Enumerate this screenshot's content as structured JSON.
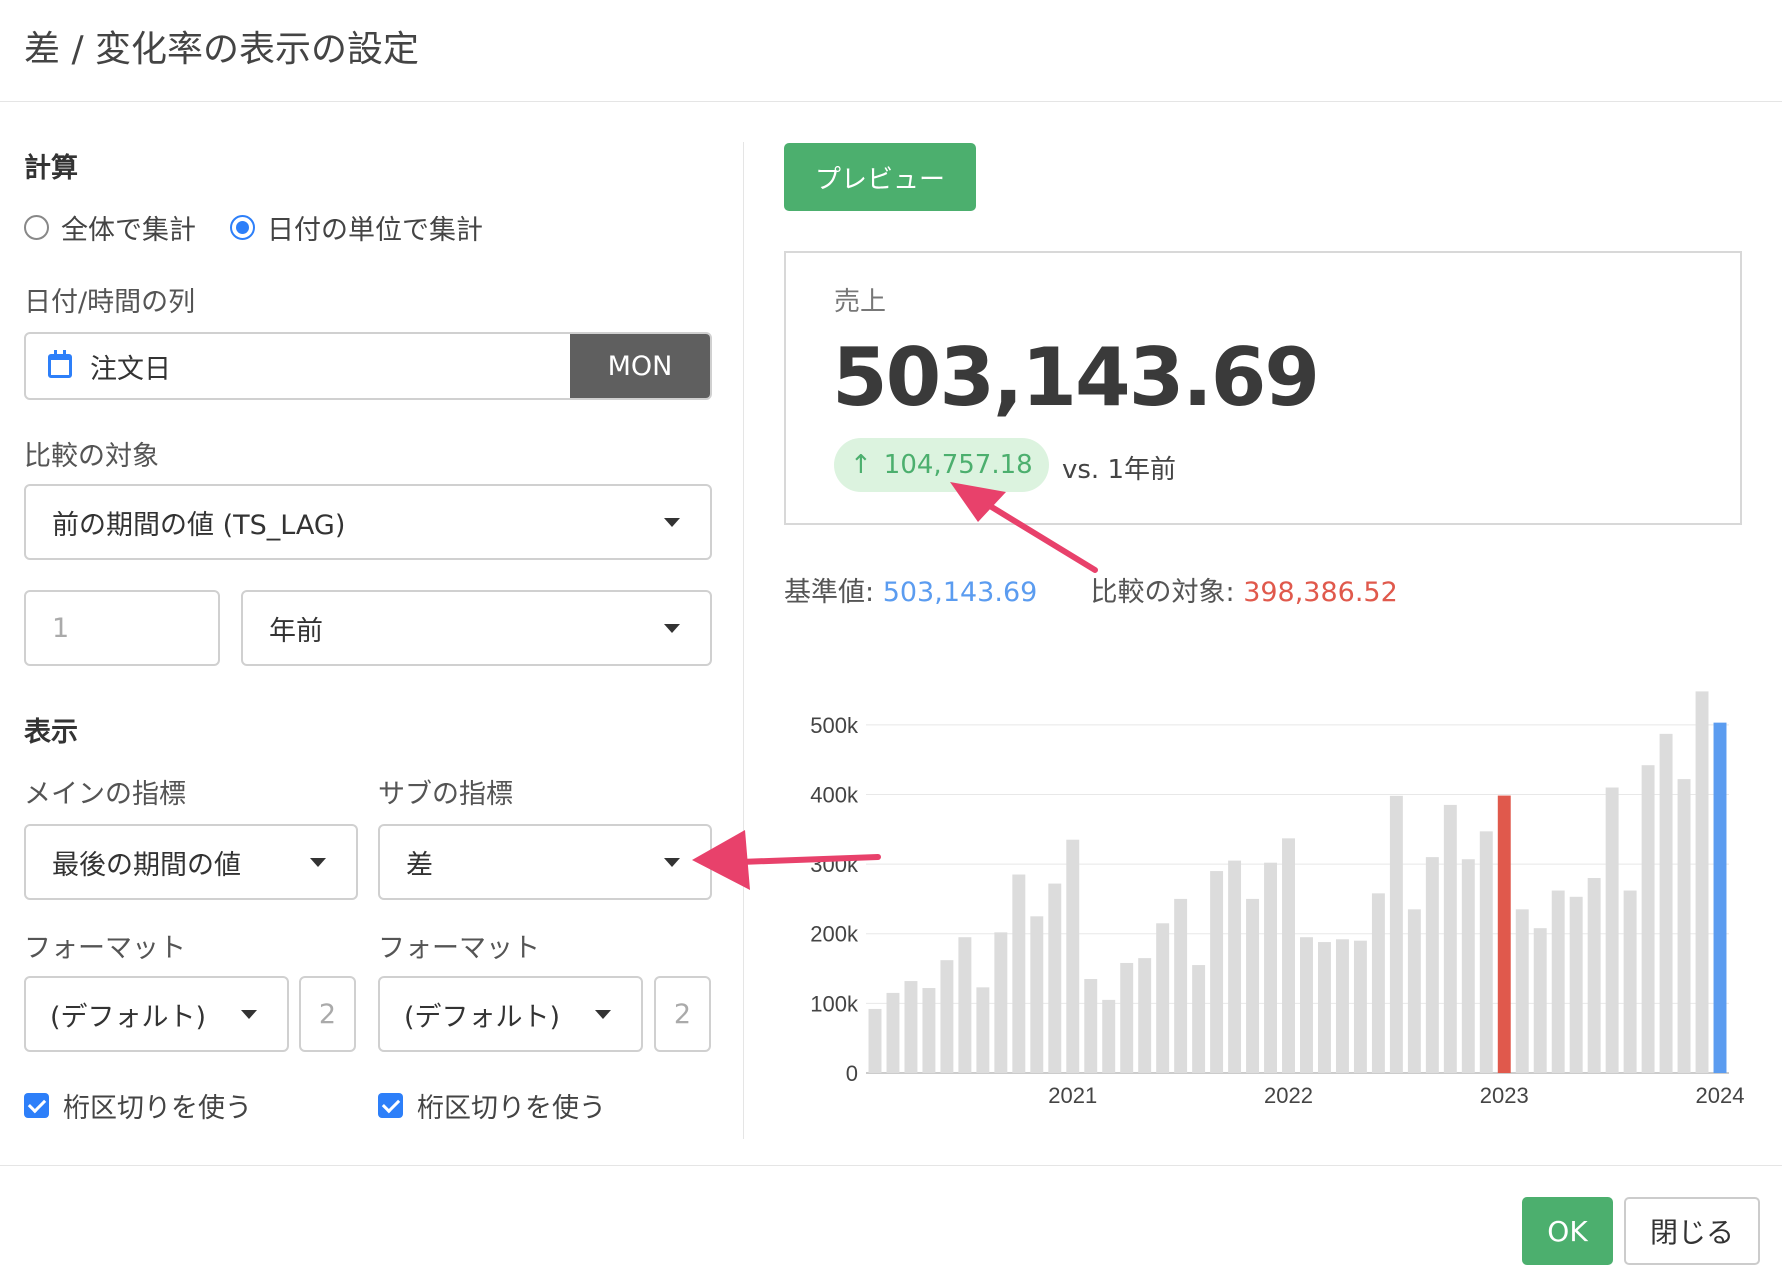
{
  "dialog": {
    "title": "差 / 変化率の表示の設定",
    "ok_label": "OK",
    "close_label": "閉じる"
  },
  "calc": {
    "section_title": "計算",
    "options": [
      "全体で集計",
      "日付の単位で集計"
    ],
    "selected_index": 1
  },
  "date_column": {
    "label": "日付/時間の列",
    "value": "注文日",
    "unit": "MON"
  },
  "compare": {
    "label": "比較の対象",
    "method": "前の期間の値 (TS_LAG)",
    "lag_placeholder": "1",
    "period": "年前"
  },
  "display": {
    "section_title": "表示",
    "main_metric_label": "メインの指標",
    "main_metric_value": "最後の期間の値",
    "sub_metric_label": "サブの指標",
    "sub_metric_value": "差",
    "main_format_label": "フォーマット",
    "main_format_value": "(デフォルト)",
    "main_digits": "2",
    "sub_format_label": "フォーマット",
    "sub_format_value": "(デフォルト)",
    "sub_digits": "2",
    "main_separator_label": "桁区切りを使う",
    "main_separator_checked": true,
    "sub_separator_label": "桁区切りを使う",
    "sub_separator_checked": true
  },
  "preview": {
    "button_label": "プレビュー",
    "card_label": "売上",
    "main_value": "503,143.69",
    "change_value": "104,757.18",
    "change_direction": "up",
    "vs_text": "vs. 1年前",
    "base_label": "基準値:",
    "base_value": "503,143.69",
    "compare_label": "比較の対象:",
    "compare_value": "398,386.52"
  },
  "colors": {
    "accent_green": "#4caf6e",
    "accent_blue": "#5b9cf0",
    "accent_red": "#e0594c",
    "bar_gray": "#dcdcdc",
    "annotation_arrow": "#e8416b"
  },
  "chart_data": {
    "type": "bar",
    "ylim": [
      0,
      550000
    ],
    "y_ticks": [
      0,
      100000,
      200000,
      300000,
      400000,
      500000
    ],
    "y_tick_labels": [
      "0",
      "100k",
      "200k",
      "300k",
      "400k",
      "500k"
    ],
    "x_tick_labels": [
      "2021",
      "2022",
      "2023",
      "2024"
    ],
    "x_tick_index": [
      11,
      23,
      35,
      47
    ],
    "highlight_compare_index": 35,
    "highlight_base_index": 47,
    "values": [
      92000,
      115000,
      132000,
      122000,
      162000,
      195000,
      123000,
      202000,
      285000,
      225000,
      272000,
      335000,
      135000,
      105000,
      158000,
      165000,
      215000,
      250000,
      155000,
      290000,
      305000,
      250000,
      302000,
      337000,
      195000,
      188000,
      192000,
      190000,
      258000,
      398000,
      235000,
      310000,
      385000,
      307000,
      347000,
      398386,
      235000,
      208000,
      262000,
      253000,
      280000,
      410000,
      262000,
      442000,
      487000,
      422000,
      548000,
      503144
    ]
  }
}
